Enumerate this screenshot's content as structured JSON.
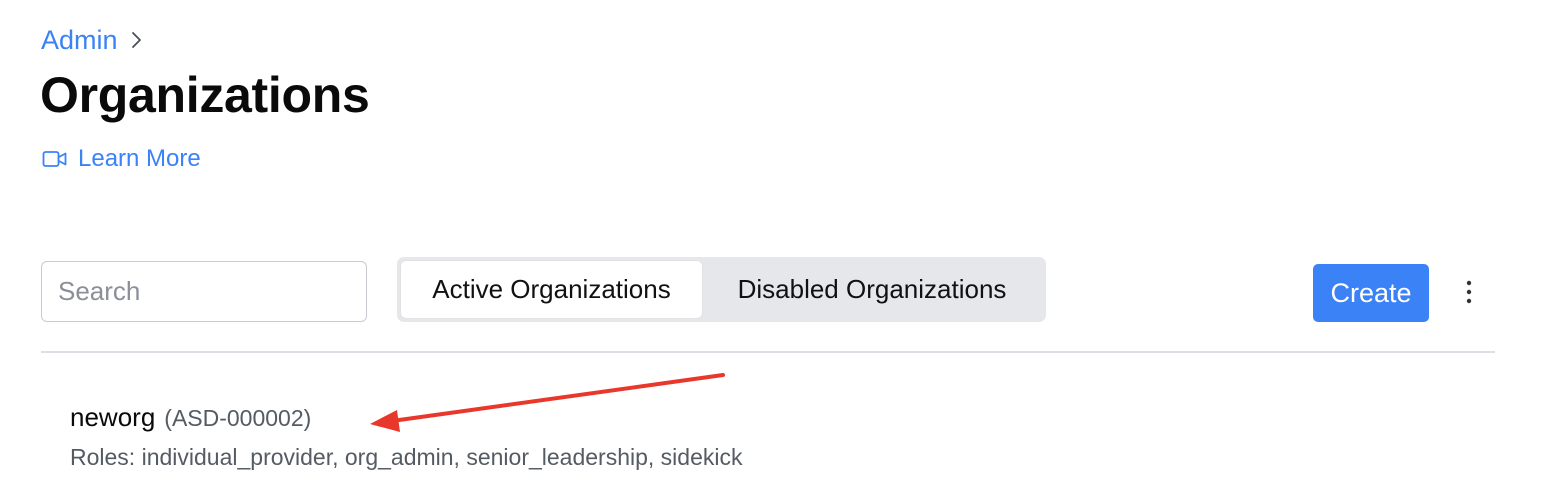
{
  "breadcrumb": {
    "items": [
      {
        "label": "Admin"
      }
    ]
  },
  "page": {
    "title": "Organizations",
    "learn_more_label": "Learn More",
    "learn_more_icon": "video-camera-icon"
  },
  "toolbar": {
    "search_placeholder": "Search",
    "search_value": "",
    "tabs": [
      {
        "label": "Active Organizations",
        "selected": true
      },
      {
        "label": "Disabled Organizations",
        "selected": false
      }
    ],
    "create_label": "Create",
    "more_icon": "vertical-dots-icon"
  },
  "organizations": [
    {
      "name": "neworg",
      "code": "(ASD-000002)",
      "roles": "Roles: individual_provider, org_admin, senior_leadership, sidekick"
    }
  ],
  "colors": {
    "accent": "#3b82f6",
    "annotation_arrow": "#e8372b",
    "segmented_bg": "#e5e7eb",
    "divider": "#dcdfe3"
  }
}
